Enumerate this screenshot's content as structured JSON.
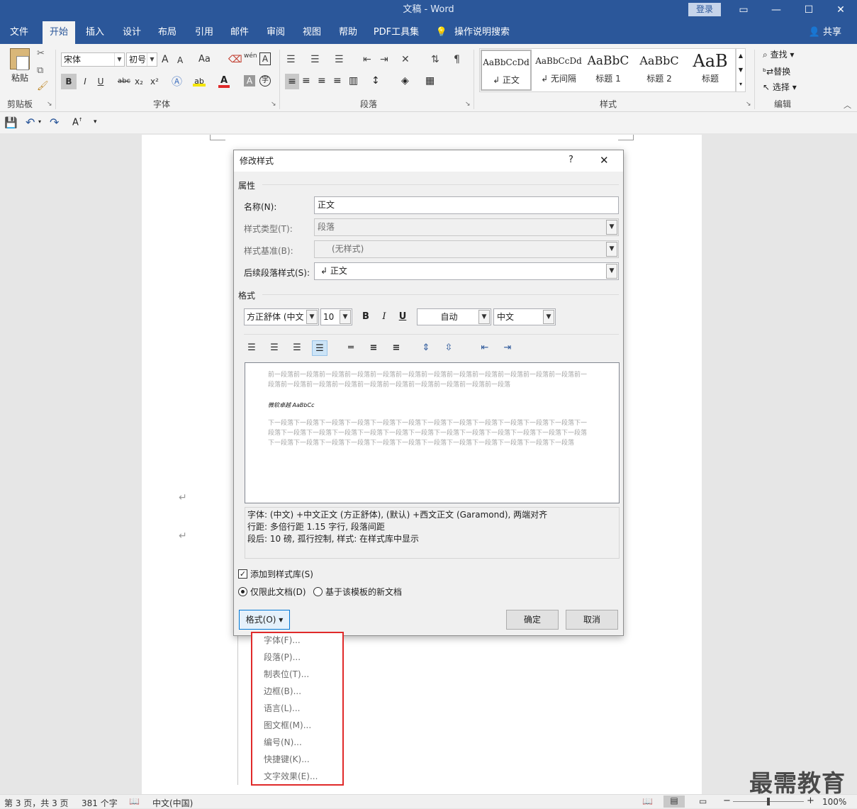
{
  "window": {
    "title": "文稿 - Word",
    "login": "登录",
    "share": "共享"
  },
  "tabs": [
    "文件",
    "开始",
    "插入",
    "设计",
    "布局",
    "引用",
    "邮件",
    "审阅",
    "视图",
    "帮助",
    "PDF工具集",
    "操作说明搜索"
  ],
  "ribbon": {
    "clipboard": {
      "paste": "粘贴",
      "group": "剪贴板"
    },
    "font": {
      "name": "宋体",
      "size": "初号",
      "group": "字体",
      "b": "B",
      "i": "I",
      "u": "U",
      "abc": "abc",
      "x2s": "x₂",
      "x2p": "x²",
      "aa_up": "A",
      "aa_down": "A",
      "aa": "Aa",
      "wen": "wén",
      "a_box": "A"
    },
    "paragraph": {
      "group": "段落"
    },
    "styles": {
      "group": "样式",
      "items": [
        {
          "preview": "AaBbCcDd",
          "name": "↲ 正文"
        },
        {
          "preview": "AaBbCcDd",
          "name": "↲ 无间隔"
        },
        {
          "preview": "AaBbC",
          "name": "标题 1"
        },
        {
          "preview": "AaBbC",
          "name": "标题 2"
        },
        {
          "preview": "AaB",
          "name": "标题"
        }
      ]
    },
    "editing": {
      "group": "编辑",
      "find": "查找",
      "replace": "替换",
      "select": "选择"
    }
  },
  "dialog": {
    "title": "修改样式",
    "help": "?",
    "close": "✕",
    "section_props": "属性",
    "name_label": "名称(N):",
    "name_value": "正文",
    "type_label": "样式类型(T):",
    "type_value": "段落",
    "based_label": "样式基准(B):",
    "based_value": "(无样式)",
    "next_label": "后续段落样式(S):",
    "next_value": "↲ 正文",
    "section_format": "格式",
    "font_value": "方正舒体 (中文",
    "size_value": "10",
    "bold": "B",
    "italic": "I",
    "underline": "U",
    "color_value": "自动",
    "lang_value": "中文",
    "preview_prev": "前一段落前一段落前一段落前一段落前一段落前一段落前一段落前一段落前一段落前一段落前一段落前一段落前一段落前一段落前一段落前一段落前一段落前一段落前一段落前一段落前一段落前一段落",
    "preview_sample": "微软卓越 AaBbCc",
    "preview_next": "下一段落下一段落下一段落下一段落下一段落下一段落下一段落下一段落下一段落下一段落下一段落下一段落下一段落下一段落下一段落下一段落下一段落下一段落下一段落下一段落下一段落下一段落下一段落下一段落下一段落下一段落下一段落下一段落下一段落下一段落下一段落下一段落下一段落下一段落下一段落下一段落下一段落",
    "description": "字体: (中文) +中文正文 (方正舒体), (默认) +西文正文 (Garamond), 两端对齐\n    行距: 多倍行距 1.15 字行, 段落间距\n    段后: 10 磅, 孤行控制, 样式: 在样式库中显示",
    "add_to_gallery": "添加到样式库(S)",
    "only_this_doc": "仅限此文档(D)",
    "new_docs": "基于该模板的新文档",
    "format_button": "格式(O) ▾",
    "ok": "确定",
    "cancel": "取消"
  },
  "format_menu": [
    "字体(F)...",
    "段落(P)...",
    "制表位(T)...",
    "边框(B)...",
    "语言(L)...",
    "图文框(M)...",
    "编号(N)...",
    "快捷键(K)...",
    "文字效果(E)..."
  ],
  "status": {
    "page": "第 3 页，共 3 页",
    "words": "381 个字",
    "lang": "中文(中国)",
    "zoom": "100%"
  },
  "watermark": "最需教育",
  "colors": {
    "brand": "#2b579a",
    "highlight": "#e02a2a"
  }
}
